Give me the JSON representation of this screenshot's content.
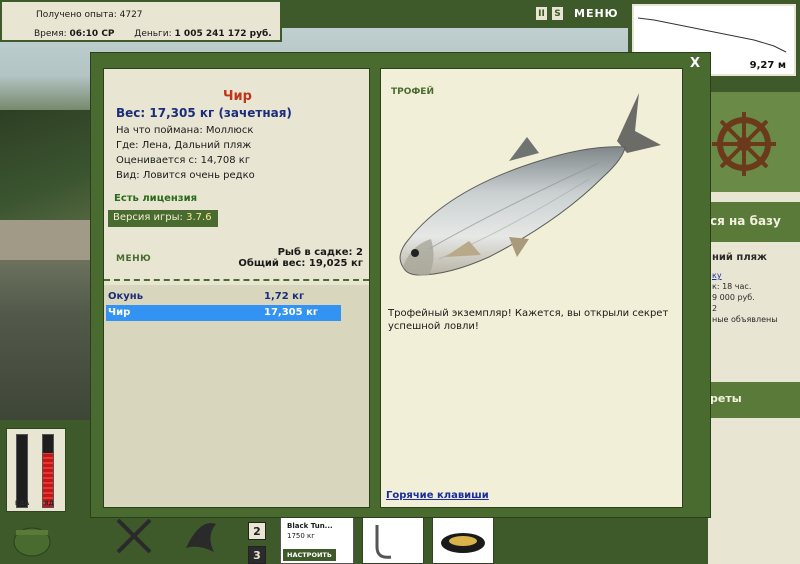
{
  "hud": {
    "exp_label": "Получено опыта:",
    "exp_value": "4727",
    "time_label": "Время:",
    "time_value": "06:10 СР",
    "money_label": "Деньги:",
    "money_value": "1 005 241 172 руб."
  },
  "top_menu": {
    "pause": "II",
    "s_button": "S",
    "menu_label": "МЕНЮ"
  },
  "depth": {
    "value": "9,27 м"
  },
  "background_panel": {
    "go_to_base": "ся на базу",
    "location": "ний пляж",
    "lines": [
      "ку",
      "к: 18 час.",
      "9 000 руб.",
      "2",
      "ные объявлены"
    ],
    "records": "реты"
  },
  "dialog": {
    "close": "X",
    "fish_name": "Чир",
    "weight_line": "Вес: 17,305 кг (зачетная)",
    "caught_on": "На что поймана: Моллюск",
    "where": "Где: Лена, Дальний пляж",
    "valued_from": "Оценивается с: 14,708 кг",
    "species_rarity": "Вид: Ловится очень редко",
    "license": "Есть лицензия",
    "version_label": "Версия игры:",
    "version_value": "3.7.6",
    "menu": "МЕНЮ",
    "fish_in_cage": "Рыб в садке: 2",
    "total_weight": "Общий вес: 19,025 кг",
    "catch_list": [
      {
        "name": "Окунь",
        "weight": "1,72 кг",
        "selected": false
      },
      {
        "name": "Чир",
        "weight": "17,305 кг",
        "selected": true
      }
    ],
    "trophy_label": "ТРОФЕЙ",
    "trophy_text": "Трофейный экземпляр! Кажется, вы открыли секрет успешной ловли!",
    "hotkeys": "Горячие клавиши"
  },
  "bottom": {
    "food_label": "ЕДА",
    "poison_label": "ЯД",
    "food_level": 0.0,
    "poison_level": 0.75,
    "slot_2": "2",
    "slot_3": "3",
    "lure_name": "Black Tun...",
    "lure_weight": "1750 кг",
    "lure_button": "НАСТРОИТЬ"
  },
  "colors": {
    "panel_green": "#4a6b2f",
    "panel_cream": "#e8e6d2",
    "selection_blue": "#3393f2",
    "title_red": "#c0361a"
  }
}
